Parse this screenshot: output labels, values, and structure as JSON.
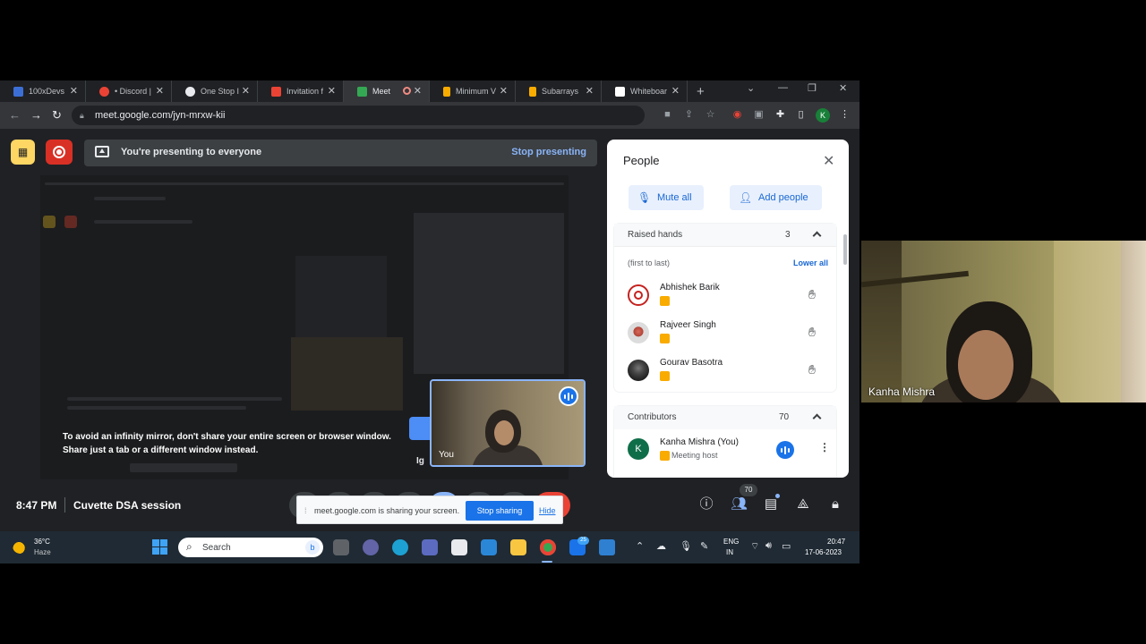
{
  "browser": {
    "tabs": [
      {
        "label": "100xDevs",
        "favicon_color": "#3c6fd6",
        "active": false
      },
      {
        "label": "• Discord |",
        "favicon_color": "#ea4335",
        "active": false
      },
      {
        "label": "One Stop I",
        "favicon_color": "#e8eaed",
        "active": false
      },
      {
        "label": "Invitation f",
        "favicon_color": "#ea4335",
        "active": false
      },
      {
        "label": "Meet",
        "favicon_color": "#34a853",
        "active": true
      },
      {
        "label": "Minimum V",
        "favicon_color": "#f9ab00",
        "active": false
      },
      {
        "label": "Subarrays",
        "favicon_color": "#f9ab00",
        "active": false
      },
      {
        "label": "Whiteboar",
        "favicon_color": "#ffffff",
        "active": false
      }
    ],
    "url": "meet.google.com/jyn-mrxw-kii",
    "profile_initial": "K"
  },
  "meet": {
    "presenting_text": "You're presenting to everyone",
    "stop_presenting_label": "Stop presenting",
    "infinity_warning": "To avoid an infinity mirror, don't share your entire screen or browser window. Share just a tab or a different window instead.",
    "ignore_partial": "Ig",
    "self_view_label": "You",
    "time": "8:47 PM",
    "meeting_name": "Cuvette DSA session",
    "people_count_badge": "70",
    "share_banner": {
      "text": "meet.google.com is sharing your screen.",
      "stop_sharing_label": "Stop sharing",
      "hide_label": "Hide"
    }
  },
  "people_panel": {
    "title": "People",
    "mute_all_label": "Mute all",
    "add_people_label": "Add people",
    "raised_hands": {
      "title": "Raised hands",
      "count": "3",
      "order_note": "(first to last)",
      "lower_all_label": "Lower all",
      "people": [
        {
          "name": "Abhishek Barik"
        },
        {
          "name": "Rajveer Singh"
        },
        {
          "name": "Gourav Basotra"
        }
      ]
    },
    "contributors": {
      "title": "Contributors",
      "count": "70",
      "first": {
        "initial": "K",
        "name": "Kanha Mishra (You)",
        "role": "Meeting host"
      }
    }
  },
  "taskbar": {
    "weather_temp": "36°C",
    "weather_condition": "Haze",
    "search_placeholder": "Search",
    "mail_badge": "25",
    "language_line1": "ENG",
    "language_line2": "IN",
    "clock_time": "20:47",
    "clock_date": "17-06-2023"
  },
  "webcam": {
    "name": "Kanha Mishra"
  },
  "colors": {
    "accent_blue": "#1a73e8",
    "link_blue": "#8ab4f8",
    "record_red": "#d93025",
    "presentation_yellow": "#fdd663"
  }
}
